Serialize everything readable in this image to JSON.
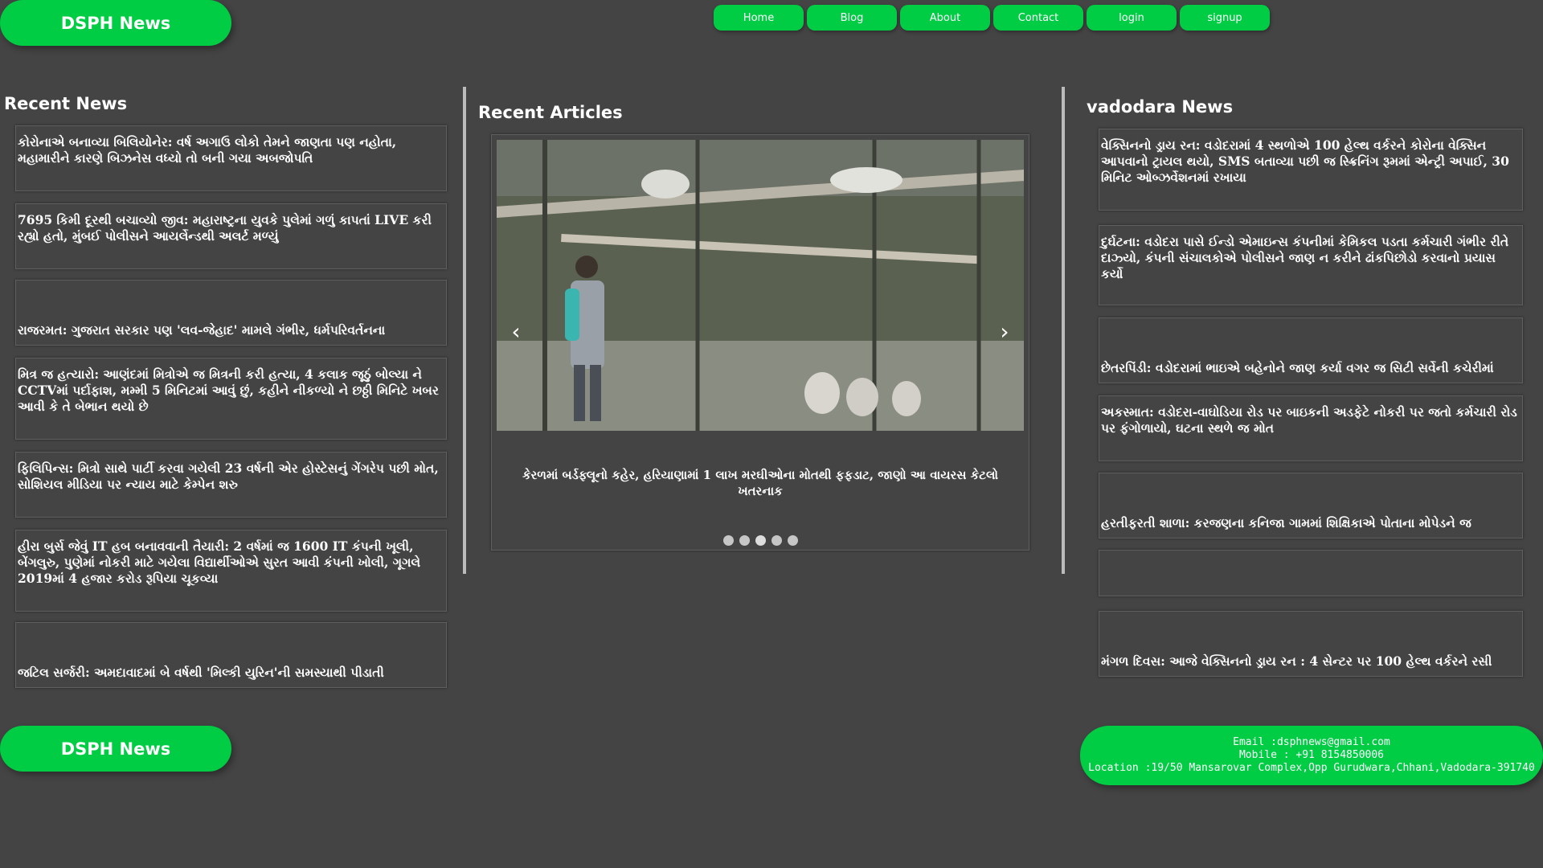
{
  "brand": {
    "name": "DSPH News",
    "accent": "#00cc44",
    "background": "#444444"
  },
  "nav": [
    "Home",
    "Blog",
    "About",
    "Contact",
    "login",
    "signup"
  ],
  "recent_news": {
    "title": "Recent News",
    "items": [
      "કોરોનાએ બનાવ્યા બિલિયોનેર: વર્ષ અગાઉ લોકો તેમને જાણતા પણ નહોતા, મહામારીને કારણે બિઝનેસ વધ્યો તો બની ગયા અબજોપતિ",
      "7695 કિમી દૂરથી બચાવ્યો જીવ: મહારાષ્ટ્રના યુવકે પુલેમાં ગળું કાપતાં LIVE કરી રહ્યો હતો, મુંબઈ પોલીસને આયર્લેન્ડથી અલર્ટ મળ્યું",
      "રાજરમત: ગુજરાત સરકાર પણ 'લવ-જેહાદ' મામલે ગંભીર, ધર્મપરિવર્તનના",
      "મિત્ર જ હત્યારો: આણંદમાં મિત્રોએ જ મિત્રની કરી હત્યા, 4 કલાક જૂઠું બોલ્યા ને CCTVમાં પર્દાફાશ, મમ્મી 5 મિનિટમાં આવું છું, કહીને નીકળ્યો ને છઠ્ઠી મિનિટે ખબર આવી કે તે બેભાન થયો છે",
      "ફિલિપિન્સ: મિત્રો સાથે પાર્ટી કરવા ગયેલી 23 વર્ષની એર હોસ્ટેસનું ગેંગરેપ પછી મોત, સોશિયલ મીડિયા પર ન્યાય માટે કેમ્પેન શરુ",
      "હીરા બુર્સ જેવું IT હબ બનાવવાની તૈયારી: 2 વર્ષમાં જ 1600 IT કંપની ખૂલી, બેંગલુરુ, પુણેમાં નોકરી માટે ગયેલા વિદ્યાર્થીઓએ સુરત આવી કંપની ખોલી, ગૂગલે 2019માં 4 હજાર કરોડ રૂપિયા ચૂકવ્યા",
      "જટિલ સર્જરી: અમદાવાદમાં બે વર્ષથી 'મિલ્કી યુરિન'ની સમસ્યાથી પીડાતી"
    ]
  },
  "recent_articles": {
    "title": "Recent Articles",
    "slider": {
      "prev_label": "‹",
      "next_label": "›",
      "caption": "કેરળમાં બર્ડફ્લૂનો કહેર, હરિયાણામાં 1 લાખ મરઘીઓના મોતથી ફફડાટ, જાણો આ વાયરસ કેટલો ખતરનાક",
      "dots": 5,
      "active_dot": 3
    }
  },
  "vadodara_news": {
    "title": "vadodara News",
    "items": [
      "વેક્સિનનો ડ્રાય રન: વડોદરામાં 4 સ્થળોએ 100 હેલ્થ વર્કરને કોરોના વેક્સિન આપવાનો ટ્રાયલ થયો, SMS બતાવ્યા પછી જ સ્ક્રિનિંગ રૂમમાં એન્ટ્રી અપાઈ, 30 મિનિટ ઓબ્ઝર્વેશનમાં રખાયા",
      "દુર્ઘટના: વડોદરા પાસે ઈન્ડો એમાઇન્સ કંપનીમાં કેમિકલ પડતા કર્મચારી ગંભીર રીતે દાઝ્યો, કંપની સંચાલકોએ પોલીસને જાણ ન કરીને ઢાંકપિછોડો કરવાનો પ્રયાસ કર્યો",
      "છેતરપિંડી: વડોદરામાં ભાઇએ બહેનોને જાણ કર્યા વગર જ સિટી સર્વેની કચેરીમાં",
      "અકસ્માત: વડોદરા-વાઘોડિયા રોડ પર બાઇકની અડફેટે નોકરી પર જતો કર્મચારી રોડ પર ફંગોળાયો, ઘટના સ્થળે જ મોત",
      "હરતીફરતી શાળા: કરજણના કનિજા ગામમાં શિક્ષિકાએ પોતાના મોપેડને જ",
      "",
      "મંગળ દિવસ: આજે વેક્સિનનો ડ્રાય રન : 4 સેન્ટર પર 100 હેલ્થ વર્કરને રસી"
    ]
  },
  "footer": {
    "email": "Email :dsphnews@gmail.com",
    "mobile": "Mobile : +91 8154850006",
    "location": "Location :19/50 Mansarovar Complex,Opp Gurudwara,Chhani,Vadodara-391740"
  }
}
